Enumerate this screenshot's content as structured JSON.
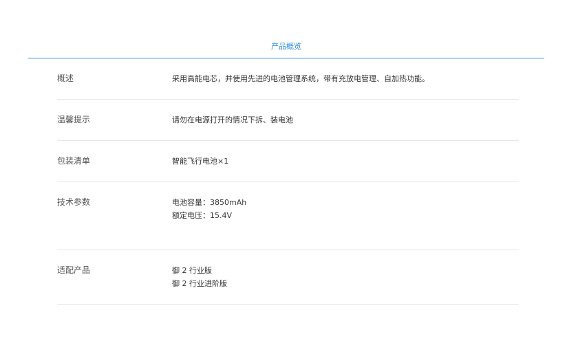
{
  "tab": {
    "label": "产品概览"
  },
  "specs": [
    {
      "label": "概述",
      "values": [
        "采用高能电芯，并使用先进的电池管理系统，带有充放电管理、自加热功能。"
      ]
    },
    {
      "label": "温馨提示",
      "values": [
        "请勿在电源打开的情况下拆、装电池"
      ]
    },
    {
      "label": "包装清单",
      "values": [
        "智能飞行电池×1"
      ]
    },
    {
      "label": "技术参数",
      "values": [
        "电池容量：3850mAh",
        "额定电压：15.4V"
      ]
    },
    {
      "label": "适配产品",
      "values": [
        "御 2 行业版",
        "御 2 行业进阶版"
      ]
    }
  ]
}
